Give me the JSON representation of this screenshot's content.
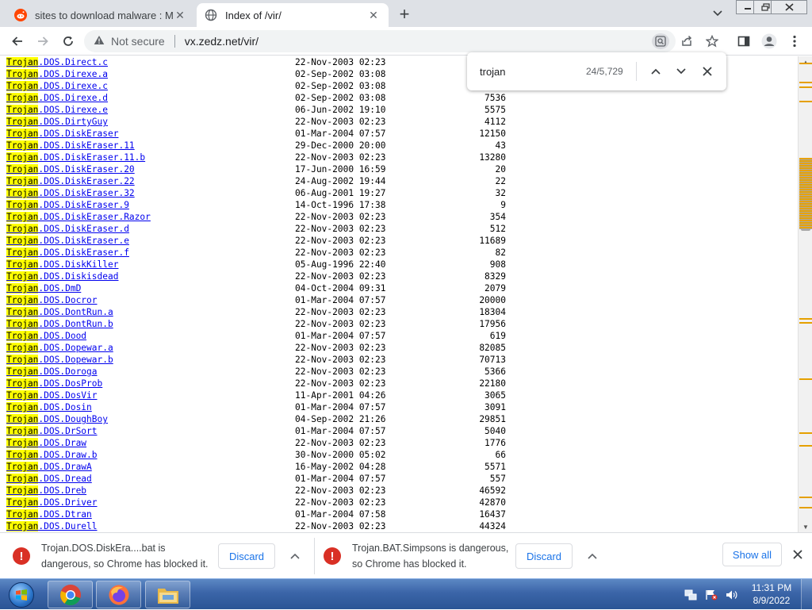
{
  "tabs": [
    {
      "title": "sites to download malware : Mal"
    },
    {
      "title": "Index of /vir/"
    }
  ],
  "toolbar": {
    "security_label": "Not secure",
    "url": "vx.zedz.net/vir/"
  },
  "find_bar": {
    "query": "trojan",
    "count": "24/5,729"
  },
  "listing": {
    "match_text": "Trojan",
    "rows": [
      {
        "rest": ".DOS.Direct.c",
        "date": "22-Nov-2003 02:23",
        "size": ""
      },
      {
        "rest": ".DOS.Direxe.a",
        "date": "02-Sep-2002 03:08",
        "size": ""
      },
      {
        "rest": ".DOS.Direxe.c",
        "date": "02-Sep-2002 03:08",
        "size": ""
      },
      {
        "rest": ".DOS.Direxe.d",
        "date": "02-Sep-2002 03:08",
        "size": "7536"
      },
      {
        "rest": ".DOS.Direxe.e",
        "date": "06-Jun-2002 19:10",
        "size": "5575"
      },
      {
        "rest": ".DOS.DirtyGuy",
        "date": "22-Nov-2003 02:23",
        "size": "4112"
      },
      {
        "rest": ".DOS.DiskEraser",
        "date": "01-Mar-2004 07:57",
        "size": "12150"
      },
      {
        "rest": ".DOS.DiskEraser.11",
        "date": "29-Dec-2000 20:00",
        "size": "43"
      },
      {
        "rest": ".DOS.DiskEraser.11.b",
        "date": "22-Nov-2003 02:23",
        "size": "13280"
      },
      {
        "rest": ".DOS.DiskEraser.20",
        "date": "17-Jun-2000 16:59",
        "size": "20"
      },
      {
        "rest": ".DOS.DiskEraser.22",
        "date": "24-Aug-2002 19:44",
        "size": "22"
      },
      {
        "rest": ".DOS.DiskEraser.32",
        "date": "06-Aug-2001 19:27",
        "size": "32"
      },
      {
        "rest": ".DOS.DiskEraser.9",
        "date": "14-Oct-1996 17:38",
        "size": "9"
      },
      {
        "rest": ".DOS.DiskEraser.Razor",
        "date": "22-Nov-2003 02:23",
        "size": "354"
      },
      {
        "rest": ".DOS.DiskEraser.d",
        "date": "22-Nov-2003 02:23",
        "size": "512"
      },
      {
        "rest": ".DOS.DiskEraser.e",
        "date": "22-Nov-2003 02:23",
        "size": "11689"
      },
      {
        "rest": ".DOS.DiskEraser.f",
        "date": "22-Nov-2003 02:23",
        "size": "82"
      },
      {
        "rest": ".DOS.DiskKiller",
        "date": "05-Aug-1996 22:40",
        "size": "908"
      },
      {
        "rest": ".DOS.Diskisdead",
        "date": "22-Nov-2003 02:23",
        "size": "8329"
      },
      {
        "rest": ".DOS.DmD",
        "date": "04-Oct-2004 09:31",
        "size": "2079"
      },
      {
        "rest": ".DOS.Docror",
        "date": "01-Mar-2004 07:57",
        "size": "20000"
      },
      {
        "rest": ".DOS.DontRun.a",
        "date": "22-Nov-2003 02:23",
        "size": "18304"
      },
      {
        "rest": ".DOS.DontRun.b",
        "date": "22-Nov-2003 02:23",
        "size": "17956"
      },
      {
        "rest": ".DOS.Dood",
        "date": "01-Mar-2004 07:57",
        "size": "619"
      },
      {
        "rest": ".DOS.Dopewar.a",
        "date": "22-Nov-2003 02:23",
        "size": "82085"
      },
      {
        "rest": ".DOS.Dopewar.b",
        "date": "22-Nov-2003 02:23",
        "size": "70713"
      },
      {
        "rest": ".DOS.Doroga",
        "date": "22-Nov-2003 02:23",
        "size": "5366"
      },
      {
        "rest": ".DOS.DosProb",
        "date": "22-Nov-2003 02:23",
        "size": "22180"
      },
      {
        "rest": ".DOS.DosVir",
        "date": "11-Apr-2001 04:26",
        "size": "3065"
      },
      {
        "rest": ".DOS.Dosin",
        "date": "01-Mar-2004 07:57",
        "size": "3091"
      },
      {
        "rest": ".DOS.DoughBoy",
        "date": "04-Sep-2002 21:26",
        "size": "29851"
      },
      {
        "rest": ".DOS.DrSort",
        "date": "01-Mar-2004 07:57",
        "size": "5040"
      },
      {
        "rest": ".DOS.Draw",
        "date": "22-Nov-2003 02:23",
        "size": "1776"
      },
      {
        "rest": ".DOS.Draw.b",
        "date": "30-Nov-2000 05:02",
        "size": "66"
      },
      {
        "rest": ".DOS.DrawA",
        "date": "16-May-2002 04:28",
        "size": "5571"
      },
      {
        "rest": ".DOS.Dread",
        "date": "01-Mar-2004 07:57",
        "size": "557"
      },
      {
        "rest": ".DOS.Dreb",
        "date": "22-Nov-2003 02:23",
        "size": "46592"
      },
      {
        "rest": ".DOS.Driver",
        "date": "22-Nov-2003 02:23",
        "size": "42870"
      },
      {
        "rest": ".DOS.Dtran",
        "date": "01-Mar-2004 07:58",
        "size": "16437"
      },
      {
        "rest": ".DOS.Durell",
        "date": "22-Nov-2003 02:23",
        "size": "44324"
      }
    ]
  },
  "downloads": [
    {
      "line1": "Trojan.DOS.DiskEra....bat is",
      "line2": "dangerous, so Chrome has blocked it.",
      "discard_label": "Discard"
    },
    {
      "line1": "Trojan.BAT.Simpsons is dangerous,",
      "line2": "so Chrome has blocked it.",
      "discard_label": "Discard"
    }
  ],
  "show_all_label": "Show all",
  "taskbar": {
    "time": "11:31 PM",
    "date": "8/9/2022"
  },
  "colors": {
    "highlight": "#ffff00",
    "link": "#0000ee",
    "danger": "#d93025",
    "accent": "#1a73e8"
  }
}
